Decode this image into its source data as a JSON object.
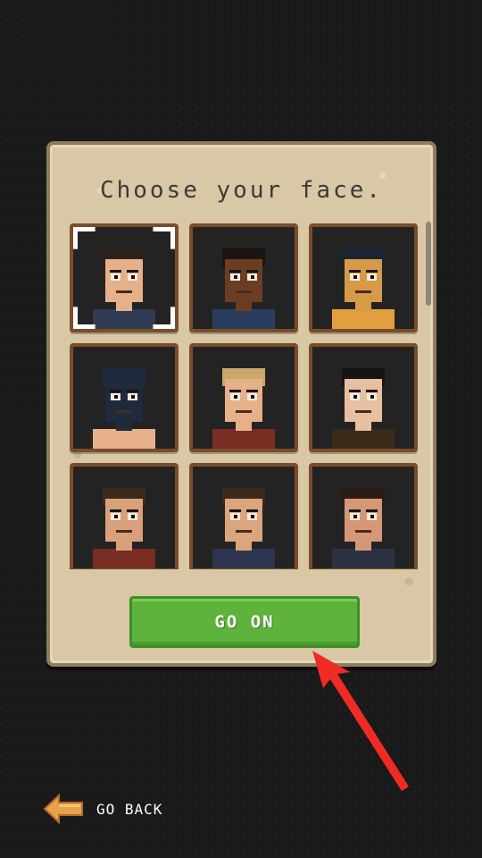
{
  "panel": {
    "title": "Choose your face.",
    "selected_index": 0,
    "faces": [
      {
        "name": "face-mustache",
        "skin": "#e6b089",
        "hair": "#2b211a",
        "accent": "#ffffff"
      },
      {
        "name": "face-braids",
        "skin": "#6b3e24",
        "hair": "#1b1410",
        "accent": "#2a3d5c"
      },
      {
        "name": "face-hooded-mask",
        "skin": "#d79a48",
        "hair": "#1a2433",
        "accent": "#e0a040"
      },
      {
        "name": "face-balaclava",
        "skin": "#1f2b3d",
        "hair": "#1f2b3d",
        "accent": "#e6b089"
      },
      {
        "name": "face-bald-blonde",
        "skin": "#e6b089",
        "hair": "#c9a86a",
        "accent": "#7a2d22"
      },
      {
        "name": "face-long-hair",
        "skin": "#e6c0a0",
        "hair": "#151515",
        "accent": "#3a2a1a"
      },
      {
        "name": "face-goatee",
        "skin": "#d9a07a",
        "hair": "#3a2a1e",
        "accent": "#7a2d22"
      },
      {
        "name": "face-tattooed",
        "skin": "#dba57e",
        "hair": "#3a2a1e",
        "accent": "#2d3550"
      },
      {
        "name": "face-stubble",
        "skin": "#d49876",
        "hair": "#2a1d16",
        "accent": "#2b3342"
      }
    ],
    "go_on_label": "GO ON"
  },
  "footer": {
    "back_label": "GO BACK"
  },
  "colors": {
    "accent_green": "#5eb33d",
    "annotation_red": "#f02a25",
    "back_arrow": "#e8a24a"
  }
}
